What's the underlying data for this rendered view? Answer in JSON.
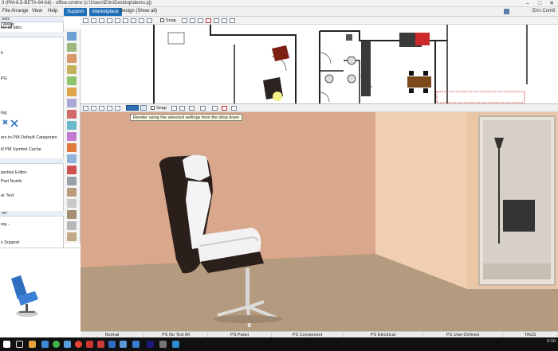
{
  "app": {
    "title": "3 (PM-8.5-BETA-64-bit) - office.cmdrw (c:\\Users\\Erin\\Desktop\\demo.pj)",
    "window_controls": [
      "–",
      "□",
      "✕"
    ]
  },
  "menubar": {
    "items": [
      "File",
      "Arrange",
      "View",
      "Help"
    ],
    "support_label": "Support",
    "marketplace_label": "Marketplace",
    "design_label": "Design (Show all)",
    "user_name": "Erin Corrill"
  },
  "left_panel": {
    "head1": "ools",
    "viewer_label": "Viewer",
    "show_all_tabs": "ow all tabs",
    "item_h": "h",
    "item_pg": "PG",
    "item_log": "log",
    "pm_default": "ers to PM Default Categories",
    "pm_symbol": "ill PM Symbol Cache",
    "properties_editor": "perties Editor",
    "part_numb": "Part Numb",
    "ar_text": "ar Text",
    "head_ort": "ort",
    "wg": "wg...",
    "support": "x Support"
  },
  "plan_toolbar": {
    "snap_label": "Snap"
  },
  "render_toolbar": {
    "snap_label": "Snap",
    "tooltip": "Render using the selected settings from the drop down"
  },
  "statusbar": {
    "tabs": [
      "Normal",
      "PS No Text All",
      "PS Panel",
      "PS Component",
      "PS Electrical",
      "PS User-Defined",
      "TAGS"
    ]
  },
  "taskbar": {
    "time": "0:10",
    "date": ""
  },
  "colors": {
    "accent": "#1f6fb9",
    "wall": "#d7a58a",
    "floor": "#b39a7e",
    "chair_dark": "#2a1e1a"
  }
}
